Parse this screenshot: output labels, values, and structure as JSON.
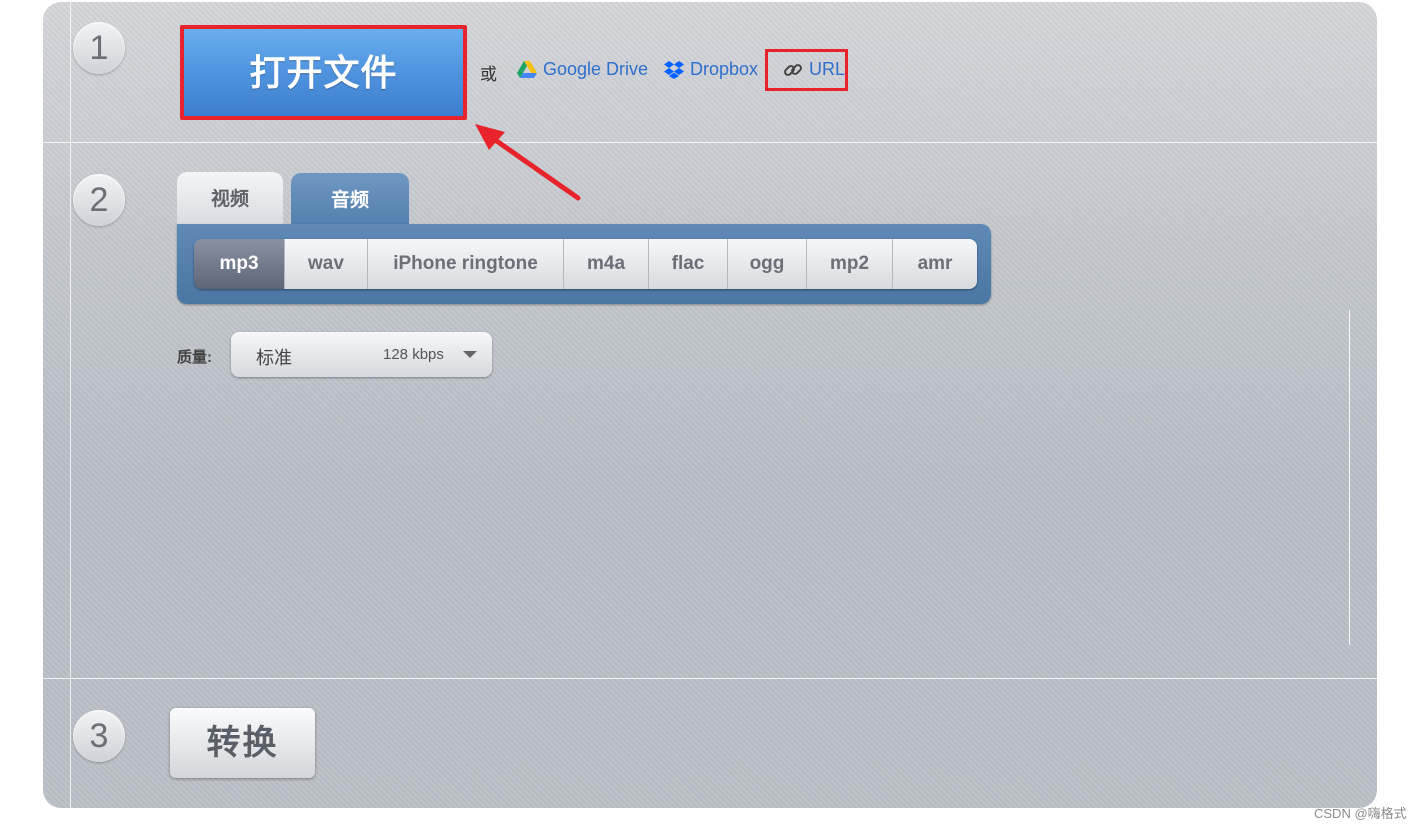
{
  "steps": {
    "one": "1",
    "two": "2",
    "three": "3"
  },
  "open_file": {
    "label": "打开文件"
  },
  "sources": {
    "or": "或",
    "google_drive": "Google Drive",
    "dropbox": "Dropbox",
    "url": "URL"
  },
  "tabs": [
    {
      "label": "视频",
      "active": false
    },
    {
      "label": "音频",
      "active": true
    }
  ],
  "formats": [
    {
      "label": "mp3",
      "active": true
    },
    {
      "label": "wav",
      "active": false
    },
    {
      "label": "iPhone ringtone",
      "active": false
    },
    {
      "label": "m4a",
      "active": false
    },
    {
      "label": "flac",
      "active": false
    },
    {
      "label": "ogg",
      "active": false
    },
    {
      "label": "mp2",
      "active": false
    },
    {
      "label": "amr",
      "active": false
    }
  ],
  "quality": {
    "label": "质量:",
    "value": "标准",
    "detail": "128 kbps"
  },
  "convert": {
    "label": "转换"
  },
  "watermark": "CSDN @嗨格式",
  "colors": {
    "accent_blue": "#4f93df",
    "highlight_red": "#e8232b",
    "link": "#2f6fce"
  }
}
